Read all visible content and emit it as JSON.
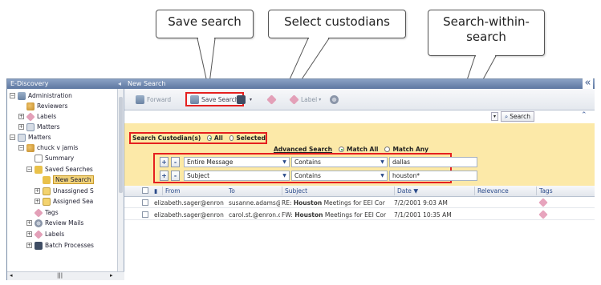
{
  "callouts": {
    "save_search": "Save search",
    "select_custodians": "Select custodians",
    "search_within_line1": "Search-within-",
    "search_within_line2": "search"
  },
  "left_panel": {
    "title": "E-Discovery",
    "tree": [
      {
        "label": "Administration",
        "icon": "admin-icon"
      },
      {
        "label": "Reviewers",
        "icon": "reviewers-icon"
      },
      {
        "label": "Labels",
        "icon": "label-icon"
      },
      {
        "label": "Matters",
        "icon": "matters-icon"
      },
      {
        "label": "Matters",
        "icon": "matters-icon"
      },
      {
        "label": "chuck v jamis",
        "icon": "matter-icon"
      },
      {
        "label": "Summary",
        "icon": "document-icon"
      },
      {
        "label": "Saved Searches",
        "icon": "saved-searches-icon"
      },
      {
        "label": "New Search",
        "icon": "search-icon"
      },
      {
        "label": "Unassigned S",
        "icon": "folder-icon"
      },
      {
        "label": "Assigned Sea",
        "icon": "folder-icon"
      },
      {
        "label": "Tags",
        "icon": "tag-icon"
      },
      {
        "label": "Review Mails",
        "icon": "mail-icon"
      },
      {
        "label": "Labels",
        "icon": "label-icon"
      },
      {
        "label": "Batch Processes",
        "icon": "batch-icon"
      }
    ]
  },
  "right_panel": {
    "title": "New Search",
    "toolbar": {
      "forward": "Forward",
      "save_search": "Save Search",
      "label": "Label"
    },
    "search_button": "Search",
    "custodian": {
      "label": "Search Custodian(s)",
      "all": "All",
      "selected": "Selected",
      "selected_option": "All"
    },
    "advanced": {
      "label": "Advanced Search",
      "match_all": "Match All",
      "match_any": "Match Any",
      "selected_option": "Match All"
    },
    "criteria": [
      {
        "field": "Entire Message",
        "operator": "Contains",
        "value": "dallas"
      },
      {
        "field": "Subject",
        "operator": "Contains",
        "value": "houston*"
      }
    ],
    "grid": {
      "columns": [
        "From",
        "To",
        "Subject",
        "Date",
        "Relevance",
        "Tags"
      ],
      "rows": [
        {
          "from": "elizabeth.sager@enron",
          "to": "susanne.adams@enro",
          "subject_prefix": "RE: ",
          "subject_bold": "Houston",
          "subject_rest": " Meetings for EEI Cor",
          "date": "7/2/2001 9:03 AM"
        },
        {
          "from": "elizabeth.sager@enron",
          "to": "carol.st.@enron.com",
          "subject_prefix": "FW: ",
          "subject_bold": "Houston",
          "subject_rest": " Meetings for EEI Cor",
          "date": "7/1/2001 10:35 AM"
        }
      ]
    }
  },
  "colors": {
    "highlight_red": "#e52020",
    "criteria_bg": "#fce9a8",
    "header_blue": "#5d77a1"
  }
}
